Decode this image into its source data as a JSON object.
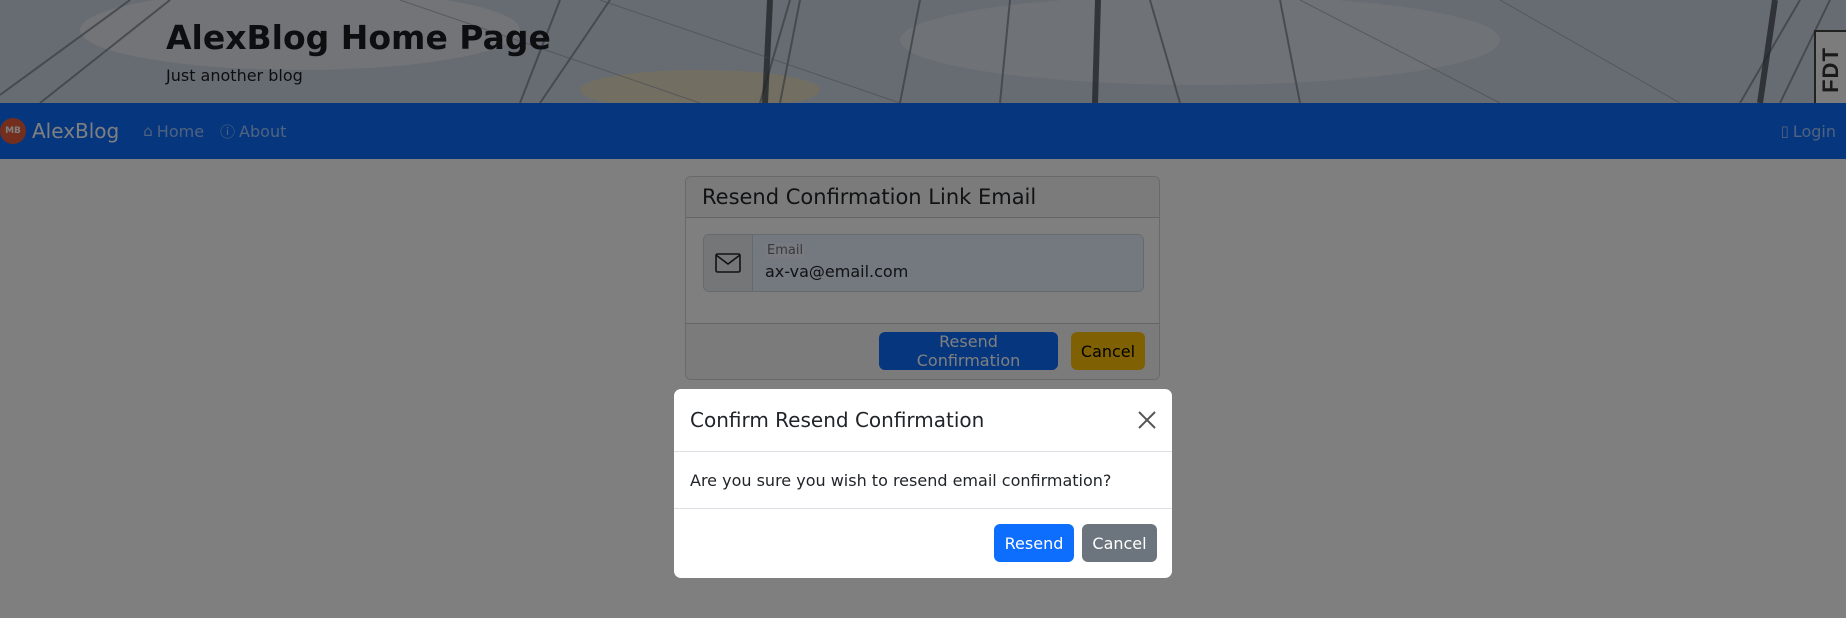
{
  "header": {
    "title": "AlexBlog Home Page",
    "subtitle": "Just another blog",
    "corner_badge": "FDT"
  },
  "navbar": {
    "brand_logo_text": "MB",
    "brand": "AlexBlog",
    "links": [
      {
        "label": "Home",
        "icon": "home-icon"
      },
      {
        "label": "About",
        "icon": "info-icon"
      }
    ],
    "login": {
      "label": "Login",
      "icon": "door-icon"
    }
  },
  "card": {
    "title": "Resend Confirmation Link Email",
    "email": {
      "label": "Email",
      "value": "ax-va@email.com",
      "icon": "envelope-icon"
    },
    "resend_button": "Resend Confirmation",
    "cancel_button": "Cancel"
  },
  "modal": {
    "title": "Confirm Resend Confirmation",
    "body": "Are you sure you wish to resend email confirmation?",
    "resend_button": "Resend",
    "cancel_button": "Cancel"
  },
  "colors": {
    "primary": "#0d6efd",
    "warning": "#ffc107",
    "secondary": "#6c757d"
  }
}
